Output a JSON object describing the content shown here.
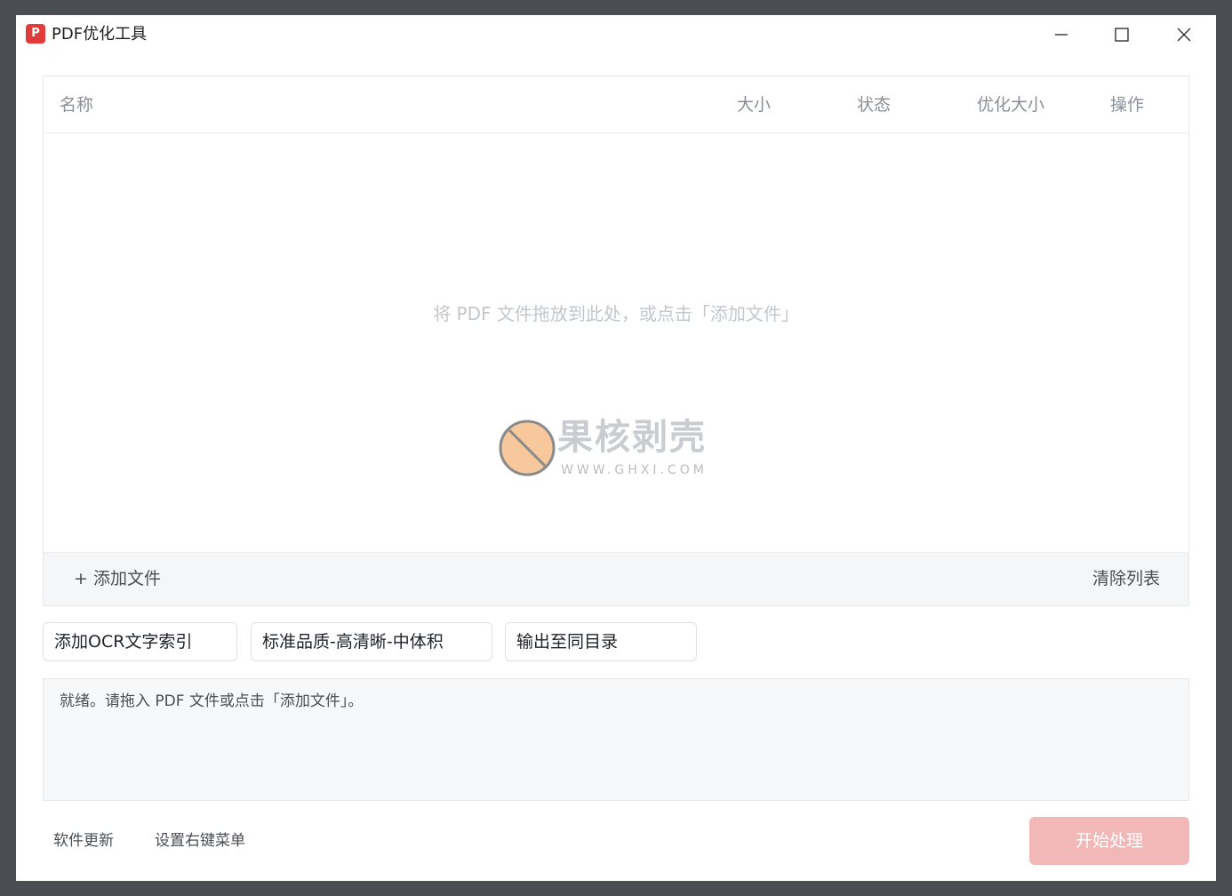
{
  "window": {
    "title": "PDF优化工具",
    "app_icon_glyph": "P"
  },
  "table": {
    "columns": [
      "名称",
      "大小",
      "状态",
      "优化大小",
      "操作"
    ],
    "empty_hint": "将 PDF 文件拖放到此处，或点击「添加文件」",
    "add_file_label": "+ 添加文件",
    "clear_list_label": "清除列表"
  },
  "watermark": {
    "text": "果核剥壳",
    "url": "WWW.GHXI.COM"
  },
  "options": {
    "ocr": "添加OCR文字索引",
    "quality": "标准品质-高清晰-中体积",
    "output": "输出至同目录"
  },
  "log": {
    "text": "就绪。请拖入 PDF 文件或点击「添加文件」。"
  },
  "footer": {
    "update_label": "软件更新",
    "context_menu_label": "设置右键菜单",
    "start_label": "开始处理"
  },
  "colors": {
    "accent": "#e23b3b",
    "start_button_disabled": "#f2b7b7",
    "background_frame": "#4a4d52"
  }
}
